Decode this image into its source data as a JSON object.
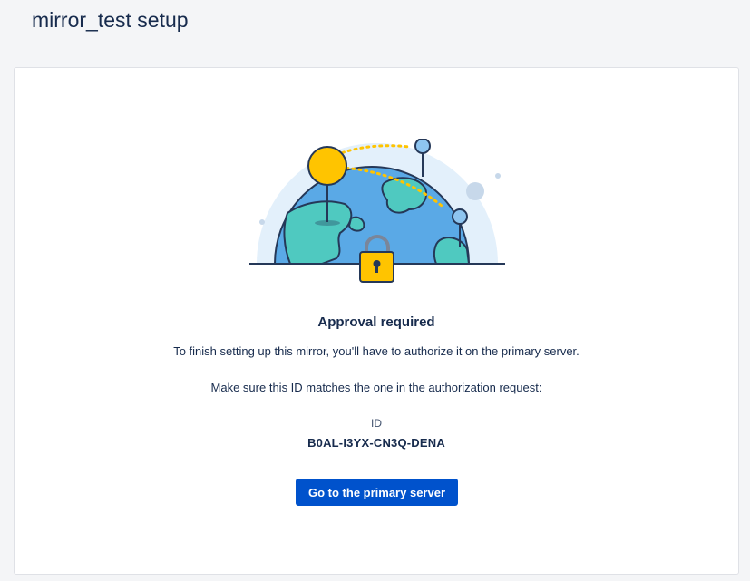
{
  "page": {
    "title": "mirror_test setup"
  },
  "approval": {
    "heading": "Approval required",
    "description": "To finish setting up this mirror, you'll have to authorize it on the primary server.",
    "instruction": "Make sure this ID matches the one in the authorization request:",
    "id_label": "ID",
    "id_value": "B0AL-I3YX-CN3Q-DENA",
    "button_label": "Go to the primary server"
  },
  "colors": {
    "background": "#f4f5f7",
    "card": "#ffffff",
    "text": "#172b4d",
    "button": "#0052cc",
    "globe_ocean": "#5aa9e6",
    "globe_land": "#4fc9c0",
    "pin_yellow": "#ffc400",
    "lock": "#ffc400"
  },
  "illustration": {
    "icon": "globe-lock-illustration"
  }
}
